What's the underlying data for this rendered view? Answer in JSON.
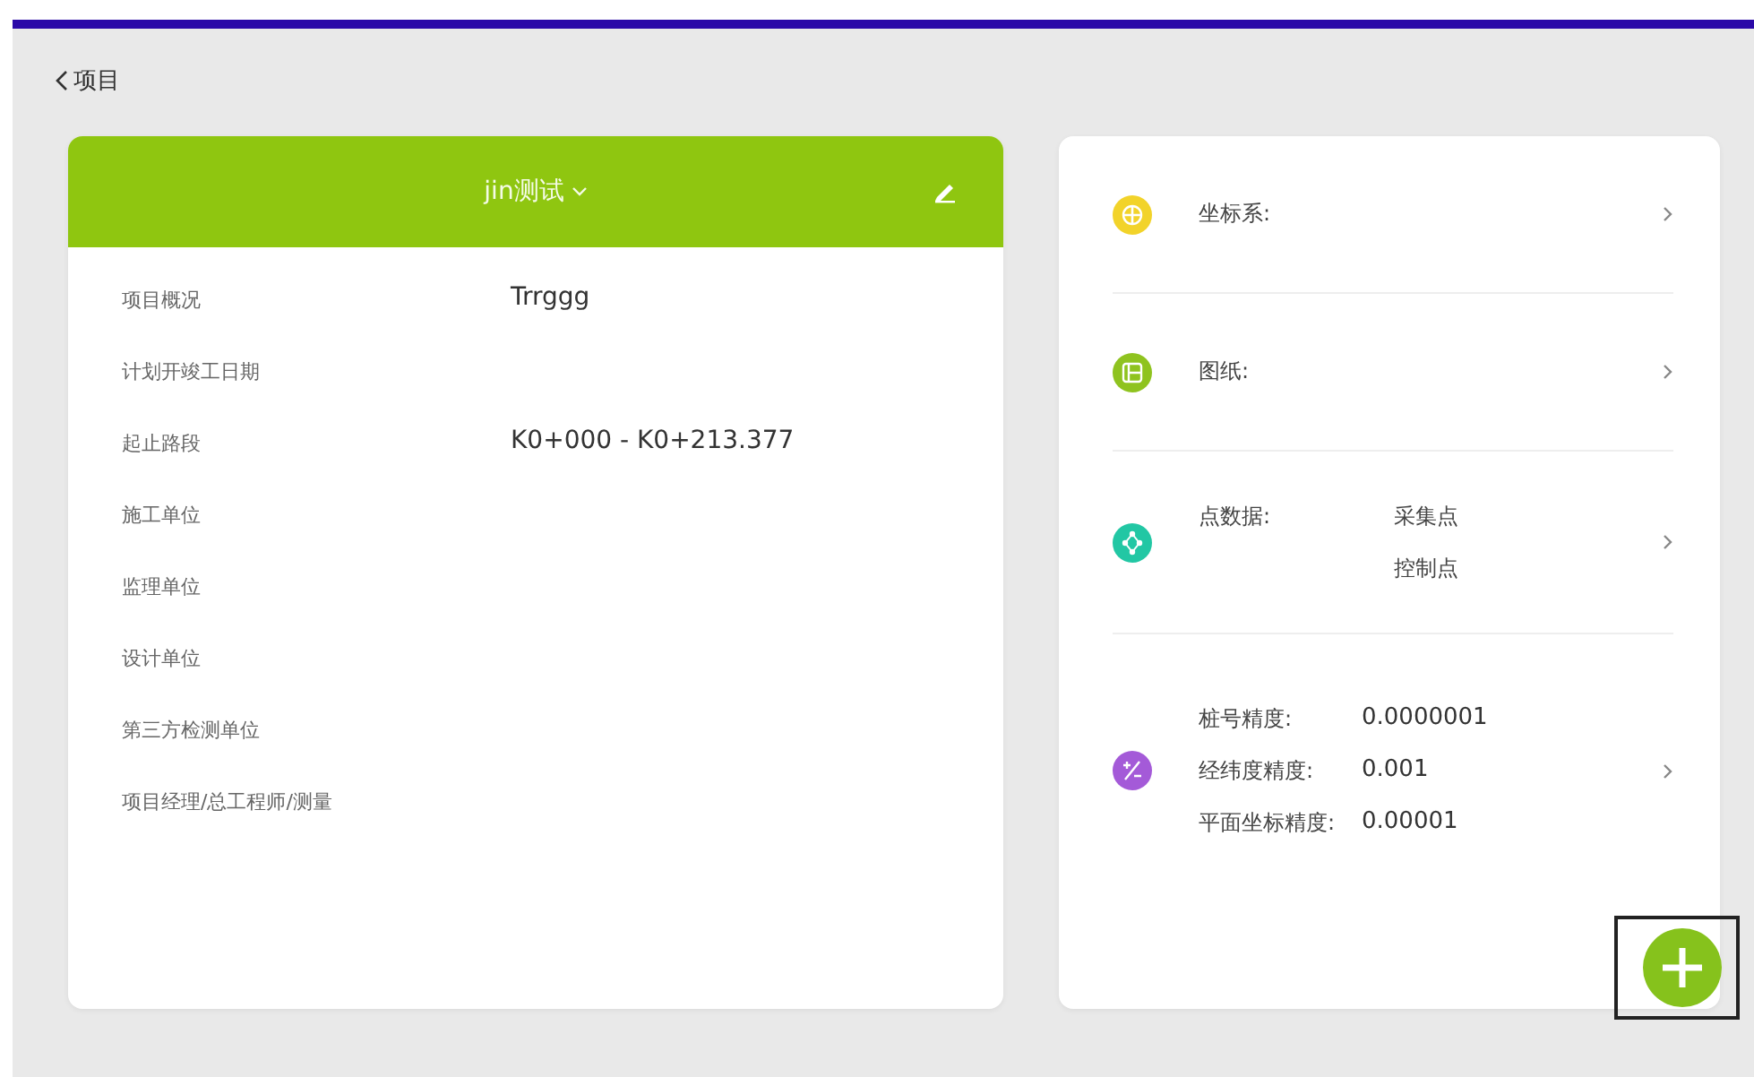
{
  "back": {
    "label": "项目"
  },
  "project": {
    "title": "jin测试",
    "fields": [
      {
        "label": "项目概况",
        "value": "Trrggg"
      },
      {
        "label": "计划开竣工日期"
      },
      {
        "label": "起止路段",
        "value": "K0+000 - K0+213.377"
      },
      {
        "label": "施工单位"
      },
      {
        "label": "监理单位"
      },
      {
        "label": "设计单位"
      },
      {
        "label": "第三方检测单位"
      },
      {
        "label": "项目经理/总工程师/测量"
      }
    ]
  },
  "settings": [
    {
      "kind": "single",
      "color": "#f2d32a",
      "label": "坐标系:"
    },
    {
      "kind": "single",
      "color": "#8fc31f",
      "label": "图纸:"
    },
    {
      "kind": "list",
      "color": "#22c7a4",
      "label": "点数据:",
      "values": [
        "采集点",
        "控制点"
      ]
    },
    {
      "kind": "pairs",
      "color": "#a45ad8",
      "pairs": [
        {
          "label": "桩号精度:",
          "value": "0.0000001"
        },
        {
          "label": "经纬度精度:",
          "value": "0.001"
        },
        {
          "label": "平面坐标精度:",
          "value": "0.00001"
        }
      ]
    }
  ]
}
